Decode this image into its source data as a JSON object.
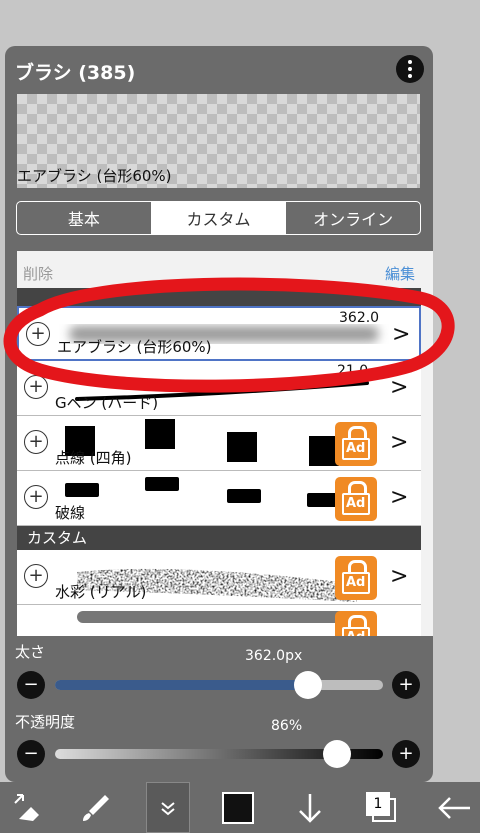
{
  "panel": {
    "title": "ブラシ (385)",
    "menu_icon": "more-vertical-icon"
  },
  "preview": {
    "brush_name": "エアブラシ (台形60%)"
  },
  "tabs": [
    {
      "label": "基本",
      "active": false
    },
    {
      "label": "カスタム",
      "active": true
    },
    {
      "label": "オンライン",
      "active": false
    }
  ],
  "list_header": {
    "delete_label": "削除",
    "edit_label": "編集"
  },
  "sections": {
    "standard": "",
    "custom": "カスタム"
  },
  "brushes": [
    {
      "name": "エアブラシ (台形60%)",
      "size": "362.0",
      "selected": true,
      "locked": false
    },
    {
      "name": "Gペン (ハード)",
      "size": "21.0",
      "selected": false,
      "locked": false
    },
    {
      "name": "点線 (四角)",
      "size": "",
      "selected": false,
      "locked": true
    },
    {
      "name": "破線",
      "size": "",
      "selected": false,
      "locked": true
    },
    {
      "name": "水彩 (リアル)",
      "size": "",
      "selected": false,
      "locked": true
    }
  ],
  "ad_label": "Ad",
  "size_slider": {
    "label": "太さ",
    "value_text": "362.0px",
    "value": 0.77,
    "minus": "−",
    "plus": "+"
  },
  "opacity_slider": {
    "label": "不透明度",
    "value_text": "86%",
    "value": 0.86,
    "minus": "−",
    "plus": "+"
  },
  "toolbar": [
    {
      "icon": "transform-eraser-icon"
    },
    {
      "icon": "brush-icon"
    },
    {
      "icon": "collapse-chevrons-icon"
    },
    {
      "icon": "color-swatch-icon",
      "color": "#111111"
    },
    {
      "icon": "arrow-down-icon"
    },
    {
      "icon": "layers-icon",
      "label": "1"
    },
    {
      "icon": "back-arrow-icon"
    }
  ],
  "colors": {
    "panel": "#6b6b6b",
    "accent_blue": "#3a5b8c",
    "ad_orange": "#f08a24",
    "annotation_red": "#e4161b"
  }
}
